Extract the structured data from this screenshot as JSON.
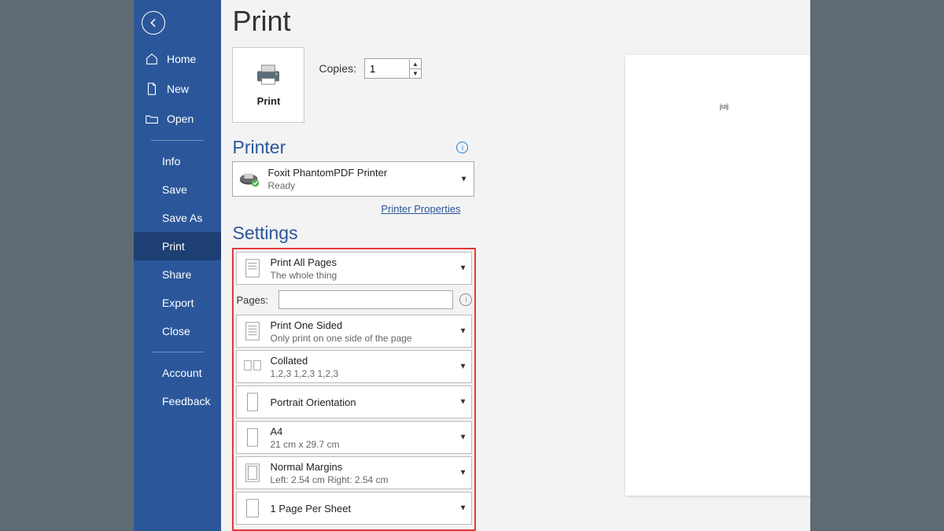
{
  "sidebar": {
    "items": [
      {
        "label": "Home"
      },
      {
        "label": "New"
      },
      {
        "label": "Open"
      },
      {
        "label": "Info"
      },
      {
        "label": "Save"
      },
      {
        "label": "Save As"
      },
      {
        "label": "Print"
      },
      {
        "label": "Share"
      },
      {
        "label": "Export"
      },
      {
        "label": "Close"
      },
      {
        "label": "Account"
      },
      {
        "label": "Feedback"
      }
    ]
  },
  "page": {
    "title": "Print"
  },
  "print_button": {
    "label": "Print"
  },
  "copies": {
    "label": "Copies:",
    "value": "1"
  },
  "printer_section": {
    "heading": "Printer"
  },
  "printer": {
    "name": "Foxit PhantomPDF Printer",
    "status": "Ready"
  },
  "printer_properties": {
    "label": "Printer Properties"
  },
  "settings_section": {
    "heading": "Settings"
  },
  "pages_field": {
    "label": "Pages:",
    "value": ""
  },
  "settings": [
    {
      "title": "Print All Pages",
      "sub": "The whole thing"
    },
    {
      "title": "Print One Sided",
      "sub": "Only print on one side of the page"
    },
    {
      "title": "Collated",
      "sub": "1,2,3    1,2,3    1,2,3"
    },
    {
      "title": "Portrait Orientation",
      "sub": ""
    },
    {
      "title": "A4",
      "sub": "21 cm x 29.7 cm"
    },
    {
      "title": "Normal Margins",
      "sub": "Left:  2.54 cm    Right:  2.54 cm"
    },
    {
      "title": "1 Page Per Sheet",
      "sub": ""
    }
  ],
  "preview": {
    "sample_text": "juij"
  }
}
